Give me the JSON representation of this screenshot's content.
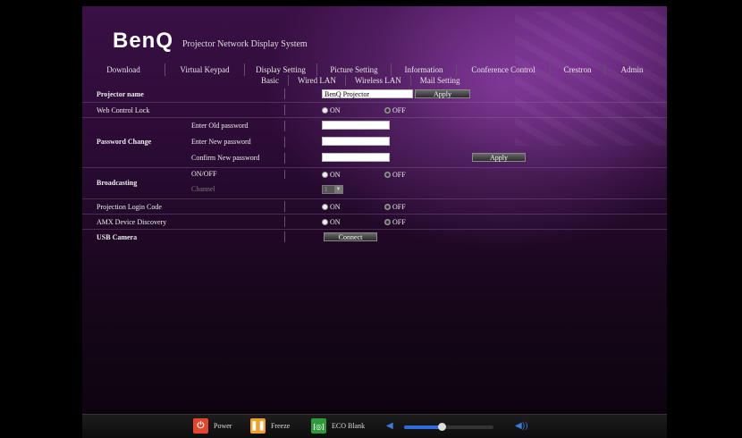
{
  "brand": {
    "logo": "BenQ",
    "subtitle": "Projector Network Display System"
  },
  "menu": [
    "Download",
    "Virtual Keypad",
    "Display Setting",
    "Picture Setting",
    "Information",
    "Conference Control",
    "Crestron",
    "Admin"
  ],
  "submenu": [
    "Basic",
    "Wired LAN",
    "Wireless LAN",
    "Mail Setting"
  ],
  "rows": {
    "projector_name": {
      "label": "Projector name",
      "value": "BenQ Projector",
      "apply": "Apply"
    },
    "web_control_lock": {
      "label": "Web Control Lock",
      "on": "ON",
      "off": "OFF",
      "selected": "OFF"
    },
    "password_change": {
      "label": "Password Change",
      "old": "Enter Old password",
      "new": "Enter New password",
      "confirm": "Confirm New password",
      "apply": "Apply"
    },
    "broadcasting": {
      "label": "Broadcasting",
      "onoff": "ON/OFF",
      "channel": "Channel",
      "channel_value": "1",
      "on": "ON",
      "off": "OFF",
      "selected": "OFF"
    },
    "projection_login": {
      "label": "Projection Login Code",
      "on": "ON",
      "off": "OFF",
      "selected": "OFF"
    },
    "amx": {
      "label": "AMX Device Discovery",
      "on": "ON",
      "off": "OFF",
      "selected": "OFF"
    },
    "usb_camera": {
      "label": "USB Camera",
      "button": "Connect"
    }
  },
  "footer": {
    "power": "Power",
    "freeze": "Freeze",
    "eco_blank": "ECO Blank",
    "volume_level": 0.42,
    "colors": {
      "power": "#e5462b",
      "freeze": "#f0a12a",
      "eco": "#2e9b3a",
      "volume": "#2d6bd9"
    }
  }
}
